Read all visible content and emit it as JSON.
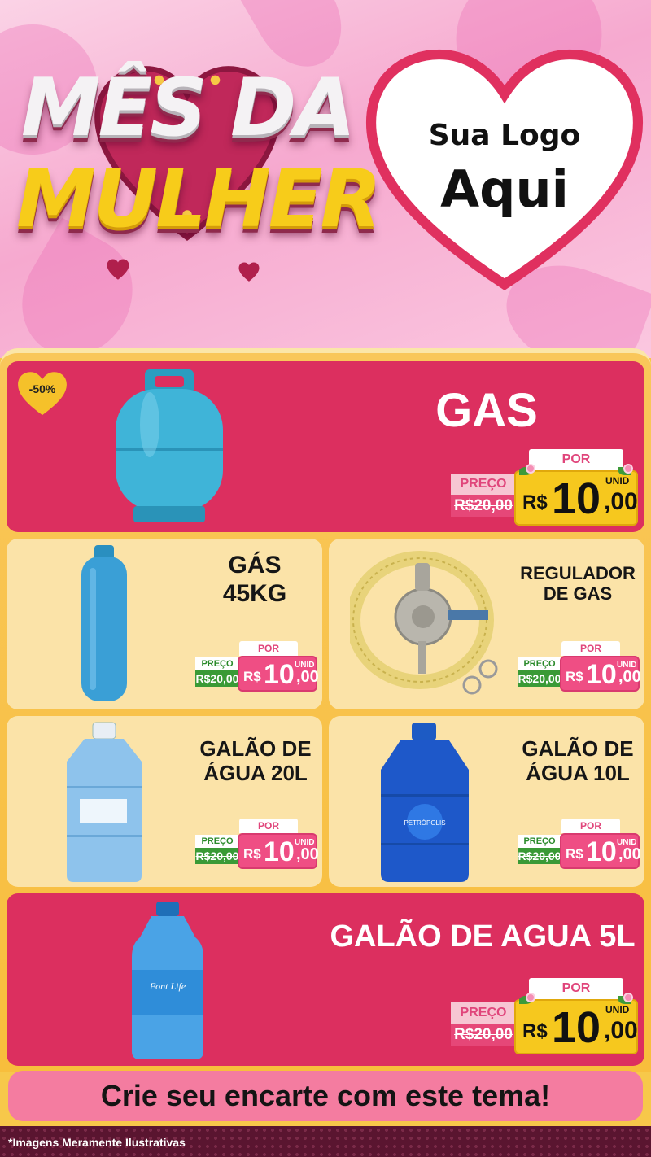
{
  "header": {
    "title_line1": "MÊS DA",
    "title_line2": "MULHER",
    "logo_line1": "Sua Logo",
    "logo_line2": "Aqui"
  },
  "products": [
    {
      "name": "GAS",
      "badge": "-50%",
      "por_label": "POR",
      "preco_label": "PREÇO",
      "old_price": "R$20,00",
      "currency": "R$",
      "price_int": "10",
      "price_dec": ",00",
      "unit": "UNID"
    },
    {
      "name_l1": "GÁS",
      "name_l2": "45KG",
      "por_label": "POR",
      "preco_label": "PREÇO",
      "old_price": "R$20,00",
      "currency": "R$",
      "price_int": "10",
      "price_dec": ",00",
      "unit": "UNID"
    },
    {
      "name_l1": "REGULADOR",
      "name_l2": "DE GAS",
      "por_label": "POR",
      "preco_label": "PREÇO",
      "old_price": "R$20,00",
      "currency": "R$",
      "price_int": "10",
      "price_dec": ",00",
      "unit": "UNID"
    },
    {
      "name_l1": "GALÃO DE",
      "name_l2": "ÁGUA 20L",
      "por_label": "POR",
      "preco_label": "PREÇO",
      "old_price": "R$20,00",
      "currency": "R$",
      "price_int": "10",
      "price_dec": ",00",
      "unit": "UNID"
    },
    {
      "name_l1": "GALÃO DE",
      "name_l2": "ÁGUA 10L",
      "por_label": "POR",
      "preco_label": "PREÇO",
      "old_price": "R$20,00",
      "currency": "R$",
      "price_int": "10",
      "price_dec": ",00",
      "unit": "UNID"
    },
    {
      "name": "GALÃO DE AGUA 5L",
      "por_label": "POR",
      "preco_label": "PREÇO",
      "old_price": "R$20,00",
      "currency": "R$",
      "price_int": "10",
      "price_dec": ",00",
      "unit": "UNID"
    }
  ],
  "cta": "Crie seu encarte com este tema!",
  "disclaimer": "*Imagens Meramente Ilustrativas",
  "bottle_labels": {
    "font_life": "Font Life",
    "petropolis": "PETRÓPOLIS"
  },
  "colors": {
    "red_card": "#dc2f5f",
    "cream_card": "#fbe3a8",
    "price_yellow": "#f6c81e",
    "cta_pink": "#f47ca0"
  }
}
